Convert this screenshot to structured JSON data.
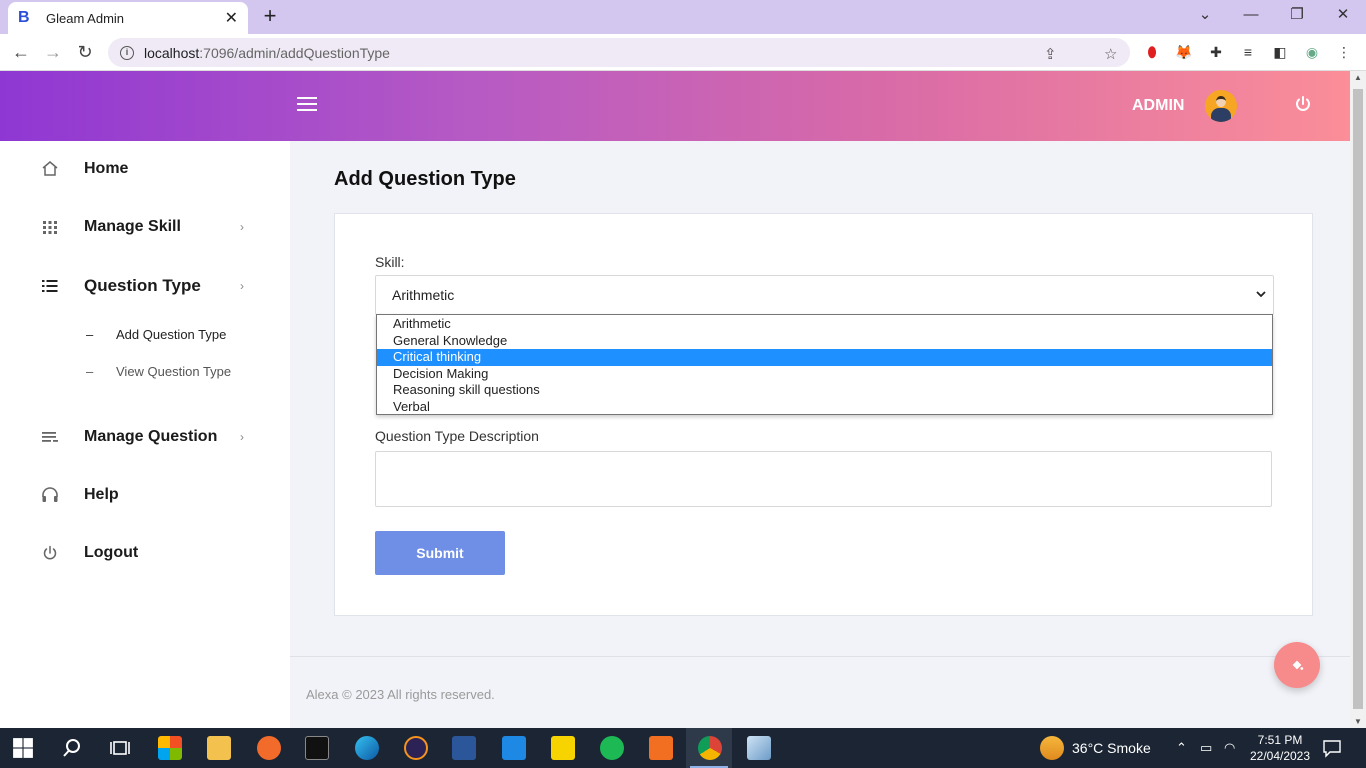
{
  "browser": {
    "tab_title": "Gleam Admin",
    "tab_favicon_letter": "B",
    "url_host": "localhost",
    "url_rest": ":7096/admin/addQuestionType"
  },
  "header": {
    "admin_label": "ADMIN"
  },
  "sidebar": {
    "items": [
      {
        "label": "Home",
        "icon": "home-icon"
      },
      {
        "label": "Manage Skill",
        "icon": "grid-icon"
      },
      {
        "label": "Question Type",
        "icon": "list-icon"
      },
      {
        "label": "Manage Question",
        "icon": "lines-icon"
      },
      {
        "label": "Help",
        "icon": "headset-icon"
      },
      {
        "label": "Logout",
        "icon": "power-icon"
      }
    ],
    "sub_items": [
      {
        "label": "Add Question Type",
        "dash": "–"
      },
      {
        "label": "View Question Type",
        "dash": "–"
      }
    ]
  },
  "main": {
    "title": "Add Question Type",
    "skill_label": "Skill:",
    "skill_selected": "Arithmetic",
    "skill_options": [
      "Arithmetic",
      "General Knowledge",
      "Critical thinking",
      "Decision Making",
      "Reasoning skill questions",
      "Verbal"
    ],
    "highlighted_option": "Critical thinking",
    "description_label": "Question Type Description",
    "submit_label": "Submit"
  },
  "footer": {
    "text": "Alexa © 2023 All rights reserved."
  },
  "taskbar": {
    "weather": "36°C  Smoke",
    "time": "7:51 PM",
    "date": "22/04/2023"
  },
  "colors": {
    "gradient_start": "#8f37d3",
    "gradient_end": "#fb8e98",
    "submit": "#6f8fe6",
    "highlight": "#1e90ff",
    "fab": "#f78a8a"
  }
}
